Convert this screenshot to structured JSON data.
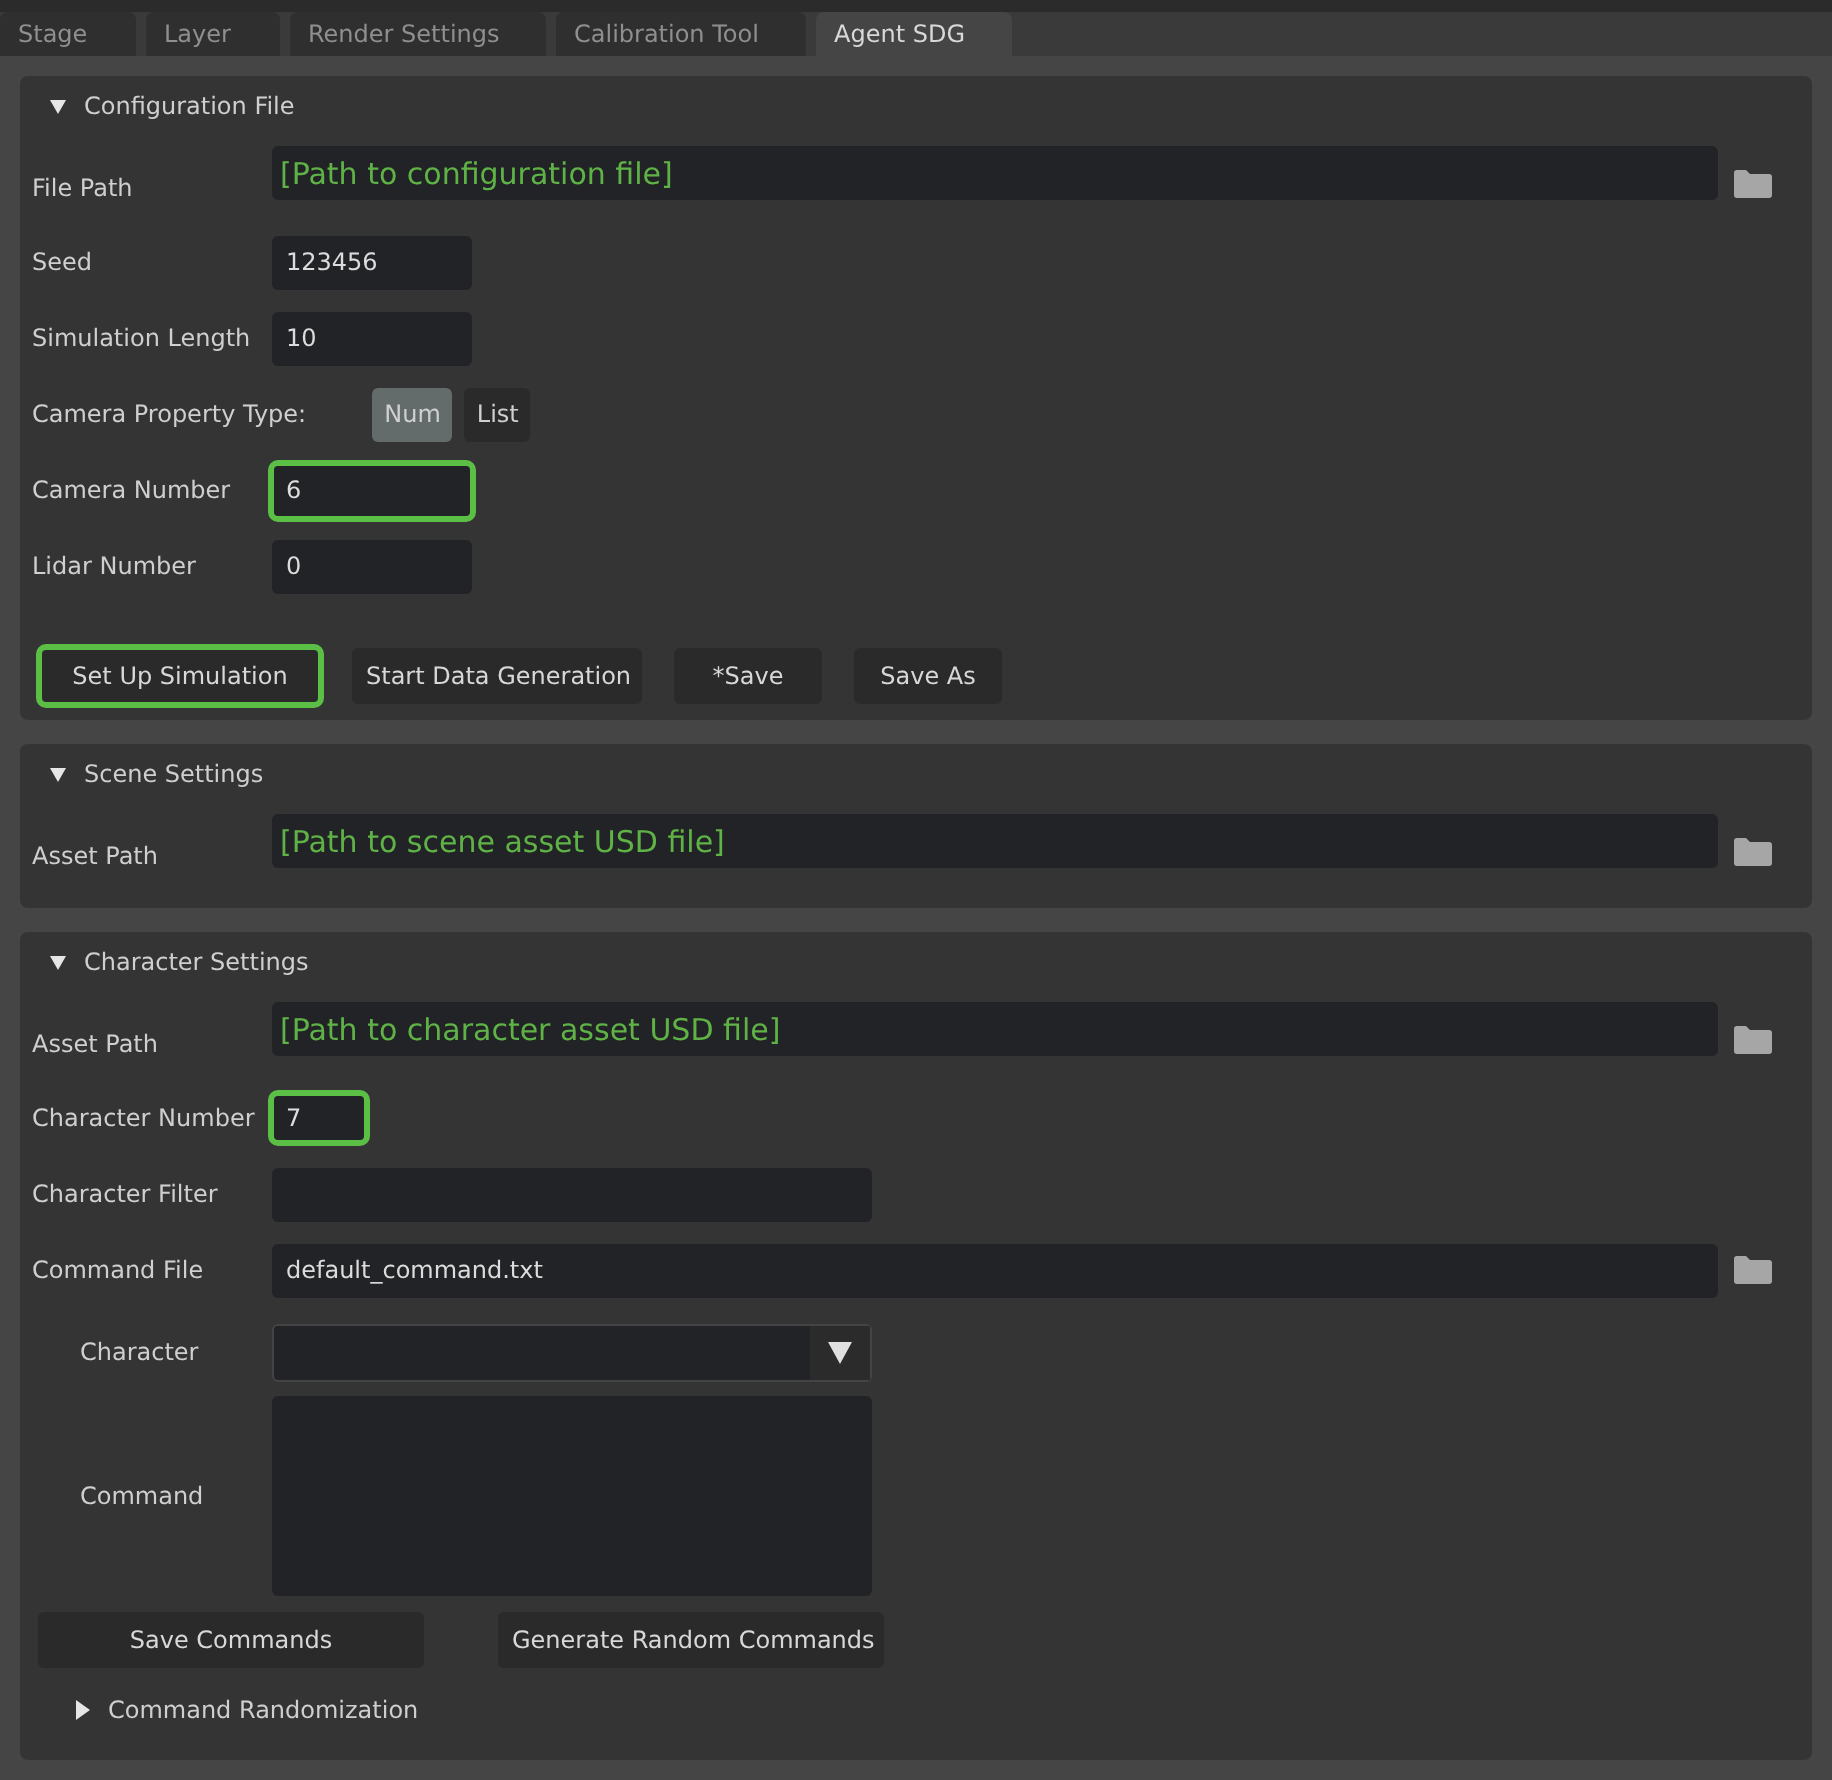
{
  "tabs": [
    {
      "label": "Stage",
      "selected": false
    },
    {
      "label": "Layer",
      "selected": false
    },
    {
      "label": "Render Settings",
      "selected": false
    },
    {
      "label": "Calibration Tool",
      "selected": false
    },
    {
      "label": "Agent SDG",
      "selected": true
    }
  ],
  "sections": [
    {
      "title": "Configuration File",
      "expanded": true,
      "rows": [
        {
          "kind": "path",
          "label": "File Path",
          "placeholder": "[Path to configuration file]"
        },
        {
          "kind": "field",
          "label": "Seed",
          "value": "123456",
          "highlighted": false
        },
        {
          "kind": "field",
          "label": "Simulation Length",
          "value": "10",
          "highlighted": false
        },
        {
          "kind": "toggle",
          "label": "Camera Property Type:",
          "options": [
            {
              "label": "Num",
              "selected": true
            },
            {
              "label": "List",
              "selected": false
            }
          ]
        },
        {
          "kind": "field",
          "label": "Camera Number",
          "value": "6",
          "highlighted": true
        },
        {
          "kind": "field",
          "label": "Lidar Number",
          "value": "0",
          "highlighted": false
        },
        {
          "kind": "buttons",
          "buttons": [
            {
              "label": "Set Up Simulation",
              "highlighted": true
            },
            {
              "label": "Start Data Generation",
              "highlighted": false
            },
            {
              "label": "*Save",
              "highlighted": false
            },
            {
              "label": "Save As",
              "highlighted": false
            }
          ]
        }
      ]
    },
    {
      "title": "Scene Settings",
      "expanded": true,
      "rows": [
        {
          "kind": "path",
          "label": "Asset Path",
          "placeholder": "[Path to scene asset USD file]"
        }
      ]
    },
    {
      "title": "Character Settings",
      "expanded": true,
      "rows": [
        {
          "kind": "path",
          "label": "Asset Path",
          "placeholder": "[Path to character asset USD file]"
        },
        {
          "kind": "small",
          "label": "Character Number",
          "value": "7",
          "highlighted": true
        },
        {
          "kind": "wide",
          "label": "Character Filter"
        },
        {
          "kind": "file",
          "label": "Command File",
          "value": "default_command.txt"
        },
        {
          "kind": "dropdown",
          "label": "Character"
        },
        {
          "kind": "textarea",
          "label": "Command"
        },
        {
          "kind": "wbuttons",
          "buttons": [
            {
              "label": "Save Commands",
              "highlighted": false
            },
            {
              "label": "Generate Random Commands",
              "highlighted": false
            }
          ]
        },
        {
          "kind": "collapsible",
          "title": "Command Randomization",
          "expanded": false
        }
      ]
    }
  ]
}
